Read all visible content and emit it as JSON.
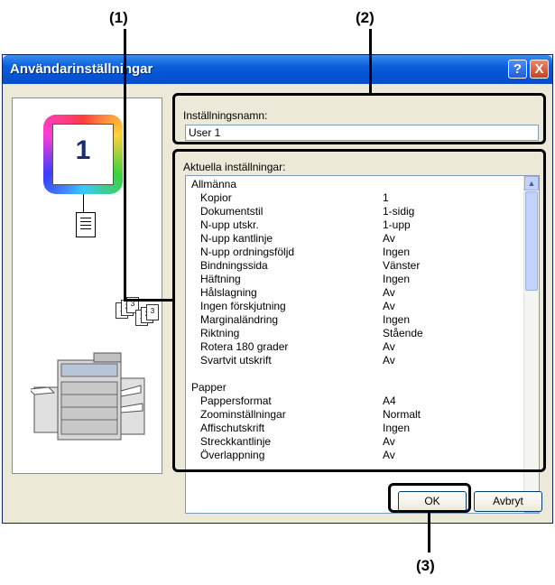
{
  "callouts": {
    "c1": "(1)",
    "c2": "(2)",
    "c3": "(3)"
  },
  "window": {
    "title": "Användarinställningar",
    "help_label": "?",
    "close_label": "X"
  },
  "preview": {
    "copy_number": "1"
  },
  "name_field": {
    "label": "Inställningsnamn:",
    "value": "User 1"
  },
  "current": {
    "label": "Aktuella inställningar:",
    "rows": [
      {
        "k": "Allmänna",
        "v": "",
        "group": true
      },
      {
        "k": "Kopior",
        "v": "1"
      },
      {
        "k": "Dokumentstil",
        "v": "1-sidig"
      },
      {
        "k": "N-upp utskr.",
        "v": "1-upp"
      },
      {
        "k": "N-upp kantlinje",
        "v": "Av"
      },
      {
        "k": "N-upp ordningsföljd",
        "v": "Ingen"
      },
      {
        "k": "Bindningssida",
        "v": "Vänster"
      },
      {
        "k": "Häftning",
        "v": "Ingen"
      },
      {
        "k": "Hålslagning",
        "v": "Av"
      },
      {
        "k": "Ingen förskjutning",
        "v": "Av"
      },
      {
        "k": "Marginaländring",
        "v": "Ingen"
      },
      {
        "k": "Riktning",
        "v": "Stående"
      },
      {
        "k": "Rotera 180 grader",
        "v": "Av"
      },
      {
        "k": "Svartvit utskrift",
        "v": "Av"
      },
      {
        "k": "",
        "v": ""
      },
      {
        "k": "Papper",
        "v": "",
        "group": true
      },
      {
        "k": "Pappersformat",
        "v": "A4"
      },
      {
        "k": "Zoominställningar",
        "v": "Normalt"
      },
      {
        "k": "Affischutskrift",
        "v": "Ingen"
      },
      {
        "k": "Streckkantlinje",
        "v": "Av"
      },
      {
        "k": "Överlappning",
        "v": "Av"
      }
    ]
  },
  "buttons": {
    "ok": "OK",
    "cancel": "Avbryt"
  }
}
